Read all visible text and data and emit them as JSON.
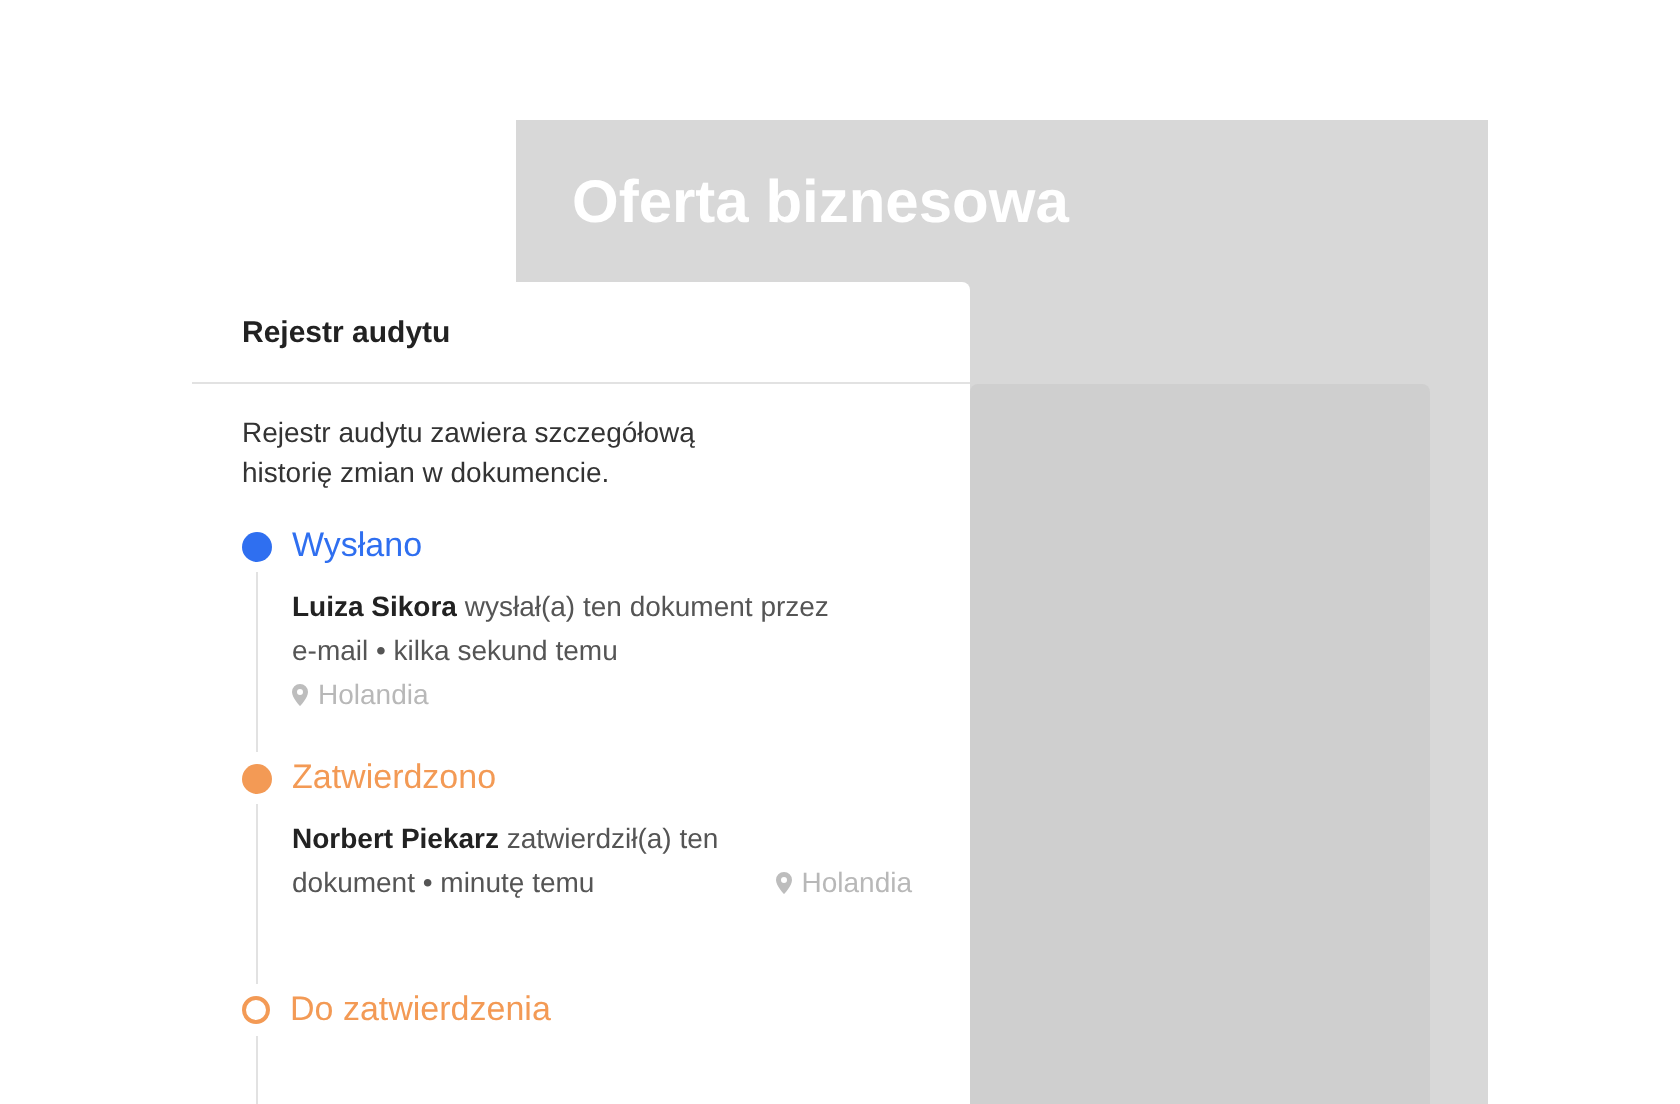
{
  "document": {
    "title": "Oferta biznesowa"
  },
  "audit_panel": {
    "title": "Rejestr audytu",
    "description": "Rejestr audytu zawiera szczegółową historię zmian w dokumencie.",
    "events": [
      {
        "kind": "done",
        "status": "Wysłano",
        "color": "#2f6ff0",
        "text": "**Luiza Sikora** wysłał(a) ten dokument przez e-mail • kilka sekund temu",
        "location": "Holandia",
        "location_inline": false
      },
      {
        "kind": "done",
        "status": "Zatwierdzono",
        "color": "#f39a55",
        "text": "**Norbert Piekarz** zatwierdził(a) ten dokument • minutę temu",
        "location": "Holandia",
        "location_inline": true
      },
      {
        "kind": "pending",
        "status": "Do zatwierdzenia",
        "color": "#f39a55"
      }
    ]
  }
}
